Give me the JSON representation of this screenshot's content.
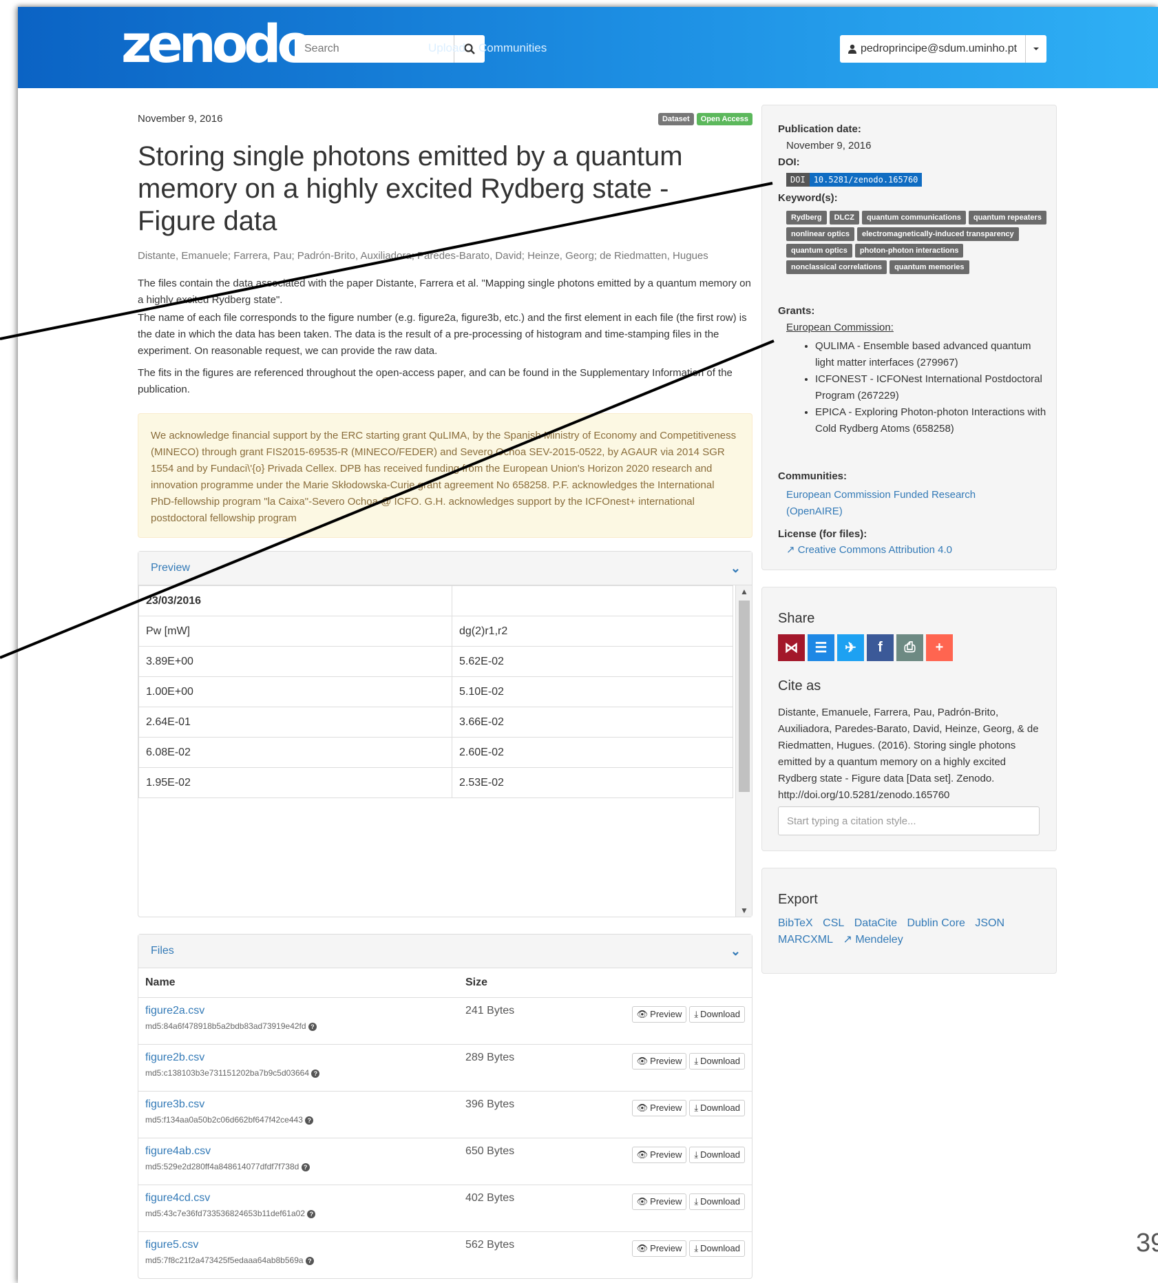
{
  "header": {
    "logo": "zenodo",
    "search_placeholder": "Search",
    "nav": [
      "Upload",
      "Communities"
    ],
    "user": "pedroprincipe@sdum.uminho.pt"
  },
  "record": {
    "date": "November 9, 2016",
    "badges": [
      {
        "label": "Dataset",
        "color": "#777777"
      },
      {
        "label": "Open Access",
        "color": "#5cb85c"
      }
    ],
    "title": "Storing single photons emitted by a quantum memory on a highly excited Rydberg state - Figure data",
    "authors": "Distante, Emanuele; Farrera, Pau; Padrón-Brito, Auxiliadora; Paredes-Barato, David; Heinze, Georg; de Riedmatten, Hugues",
    "paragraphs": [
      "The files contain the data associated with the paper Distante, Farrera et al. \"Mapping single photons emitted by a quantum memory on a highly excited Rydberg state\".",
      "The name of each file corresponds to the figure number (e.g. figure2a, figure3b, etc.) and the first element in each file (the first row) is the date in which the data has been taken. The data is the result of a pre-processing of histogram and time-stamping files in the experiment. On reasonable request, we can provide the raw data.",
      "The fits in the figures are referenced throughout the open-access paper, and can be found in the Supplementary Information of the publication."
    ],
    "acknowledgement": "We acknowledge financial support by the ERC starting grant QuLIMA, by the Spanish Ministry of Economy and Competitiveness (MINECO) through grant FIS2015-69535-R (MINECO/FEDER) and Severo Ochoa SEV-2015-0522, by AGAUR via 2014 SGR 1554 and by Fundaci\\'{o} Privada Cellex. DPB has received funding from the European Union's Horizon 2020 research and innovation programme under the Marie Skłodowska-Curie grant agreement No 658258. P.F. acknowledges the International PhD-fellowship program \"la Caixa\"-Severo Ochoa @ ICFO. G.H. acknowledges support by the ICFOnest+ international postdoctoral fellowship program"
  },
  "preview": {
    "heading": "Preview",
    "rows": [
      [
        "23/03/2016",
        ""
      ],
      [
        "Pw [mW]",
        "dg(2)r1,r2"
      ],
      [
        "3.89E+00",
        "5.62E-02"
      ],
      [
        "1.00E+00",
        "5.10E-02"
      ],
      [
        "2.64E-01",
        "3.66E-02"
      ],
      [
        "6.08E-02",
        "2.60E-02"
      ],
      [
        "1.95E-02",
        "2.53E-02"
      ]
    ]
  },
  "files": {
    "heading": "Files",
    "col_name": "Name",
    "col_size": "Size",
    "preview_label": "Preview",
    "download_label": "Download",
    "items": [
      {
        "name": "figure2a.csv",
        "md5": "md5:84a6f478918b5a2bdb83ad73919e42fd",
        "size": "241 Bytes"
      },
      {
        "name": "figure2b.csv",
        "md5": "md5:c138103b3e731151202ba7b9c5d03664",
        "size": "289 Bytes"
      },
      {
        "name": "figure3b.csv",
        "md5": "md5:f134aa0a50b2c06d662bf647f42ce443",
        "size": "396 Bytes"
      },
      {
        "name": "figure4ab.csv",
        "md5": "md5:529e2d280ff4a848614077dfdf7f738d",
        "size": "650 Bytes"
      },
      {
        "name": "figure4cd.csv",
        "md5": "md5:43c7e36fd733536824653b11def61a02",
        "size": "402 Bytes"
      },
      {
        "name": "figure5.csv",
        "md5": "md5:7f8c21f2a473425f5edaaa64ab8b569a",
        "size": "562 Bytes"
      }
    ]
  },
  "sidebar": {
    "pub_date_label": "Publication date:",
    "pub_date": "November 9, 2016",
    "doi_label": "DOI:",
    "doi_key": "DOI",
    "doi_value": "10.5281/zenodo.165760",
    "keywords_label": "Keyword(s):",
    "keywords": [
      "Rydberg",
      "DLCZ",
      "quantum communications",
      "quantum repeaters",
      "nonlinear optics",
      "electromagnetically-induced transparency",
      "quantum optics",
      "photon-photon interactions",
      "nonclassical correlations",
      "quantum memories"
    ],
    "grants_label": "Grants:",
    "grants_funder": "European Commission:",
    "grants": [
      "QULIMA - Ensemble based advanced quantum light matter interfaces (279967)",
      "ICFONEST - ICFONest International Postdoctoral Program (267229)",
      "EPICA - Exploring Photon-photon Interactions with Cold Rydberg Atoms (658258)"
    ],
    "communities_label": "Communities:",
    "community": "European Commission Funded Research (OpenAIRE)",
    "license_label": "License (for files):",
    "license": "Creative Commons Attribution 4.0"
  },
  "share": {
    "heading": "Share",
    "icons": [
      {
        "name": "mendeley-icon",
        "color": "#a3172a"
      },
      {
        "name": "list-icon",
        "color": "#1e88e5"
      },
      {
        "name": "twitter-icon",
        "color": "#1da1f2"
      },
      {
        "name": "facebook-icon",
        "color": "#3b5998"
      },
      {
        "name": "print-icon",
        "color": "#6d8a83"
      },
      {
        "name": "plus-icon",
        "color": "#ff6550"
      }
    ],
    "cite_heading": "Cite as",
    "citation": "Distante, Emanuele, Farrera, Pau, Padrón-Brito, Auxiliadora, Paredes-Barato, David, Heinze, Georg, & de Riedmatten, Hugues. (2016). Storing single photons emitted by a quantum memory on a highly excited Rydberg state - Figure data [Data set]. Zenodo. http://doi.org/10.5281/zenodo.165760",
    "cite_placeholder": "Start typing a citation style..."
  },
  "export": {
    "heading": "Export",
    "links": [
      "BibTeX",
      "CSL",
      "DataCite",
      "Dublin Core",
      "JSON",
      "MARCXML",
      "Mendeley"
    ]
  },
  "page_number": "39"
}
